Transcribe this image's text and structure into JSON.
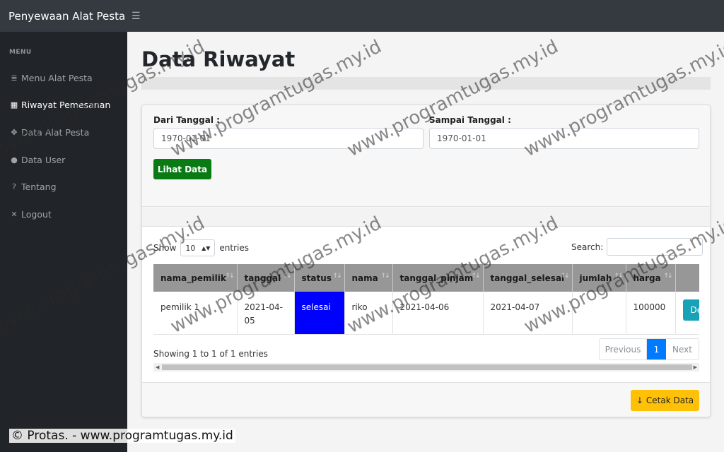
{
  "app": {
    "brand": "Penyewaan Alat Pesta"
  },
  "sidebar": {
    "heading": "MENU",
    "items": [
      {
        "label": "Menu Alat Pesta",
        "icon": "list-icon",
        "glyph": "≣"
      },
      {
        "label": "Riwayat Pemesanan",
        "icon": "calendar-icon",
        "glyph": "▦"
      },
      {
        "label": "Data Alat Pesta",
        "icon": "cubes-icon",
        "glyph": "✥"
      },
      {
        "label": "Data User",
        "icon": "user-icon",
        "glyph": "●"
      },
      {
        "label": "Tentang",
        "icon": "question-circle-icon",
        "glyph": "?"
      },
      {
        "label": "Logout",
        "icon": "times-circle-icon",
        "glyph": "✕"
      }
    ]
  },
  "page": {
    "title": "Data Riwayat"
  },
  "filter": {
    "from_label": "Dari Tanggal :",
    "from_value": "1970-01-01",
    "to_label": "Sampai Tanggal :",
    "to_value": "1970-01-01",
    "button": "Lihat Data"
  },
  "table": {
    "show_label": "Show",
    "length_value": "10",
    "entries_label": "entries",
    "search_label": "Search:",
    "columns": [
      "nama_pemilik",
      "tanggal",
      "status",
      "nama",
      "tanggal_pinjam",
      "tanggal_selesai",
      "jumlah",
      "harga",
      ""
    ],
    "rows": [
      {
        "nama_pemilik": "pemilik 1",
        "tanggal": "2021-04-05",
        "status": "selesai",
        "nama": "riko",
        "tanggal_pinjam": "2021-04-06",
        "tanggal_selesai": "2021-04-07",
        "jumlah": "",
        "harga": "100000",
        "action": "Detail"
      }
    ],
    "info": "Showing 1 to 1 of 1 entries",
    "pager": {
      "previous": "Previous",
      "current": "1",
      "next": "Next"
    }
  },
  "actions": {
    "print": "Cetak Data"
  },
  "watermark": {
    "text": "www.programtugas.my.id"
  },
  "footer": {
    "copyright": "© Protas. - www.programtugas.my.id"
  },
  "colors": {
    "topbar": "#343a40",
    "sidebar": "#212529",
    "status_selesai": "#0000ff",
    "btn_success": "#0a7a14",
    "btn_info": "#17a2b8",
    "btn_warning": "#ffc107",
    "pager_active": "#007bff"
  }
}
